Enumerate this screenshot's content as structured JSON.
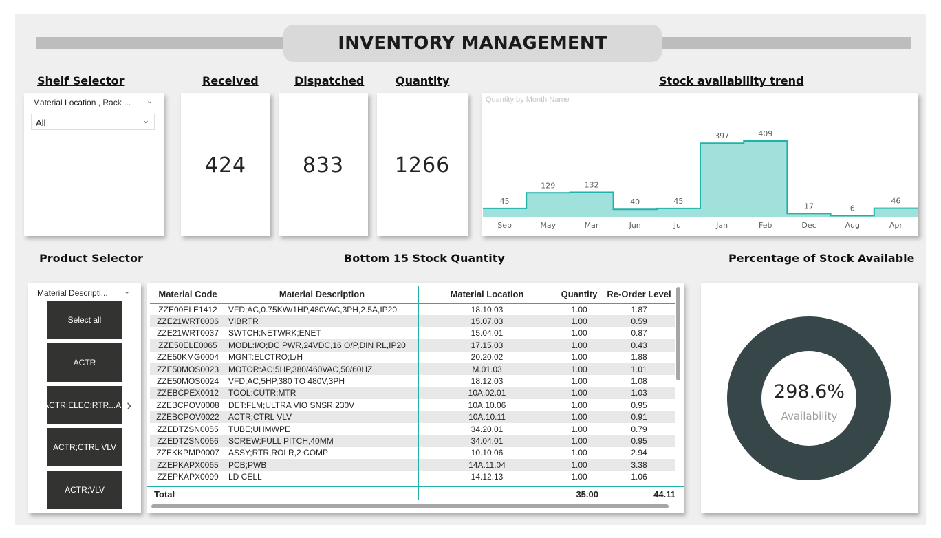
{
  "dashboard": {
    "title": "INVENTORY MANAGEMENT"
  },
  "sections": {
    "shelf_selector": "Shelf Selector",
    "received": "Received",
    "dispatched": "Dispatched",
    "quantity": "Quantity",
    "trend": "Stock availability trend",
    "product_selector": "Product Selector",
    "bottom15": "Bottom 15 Stock Quantity",
    "percentage": "Percentage of Stock Available"
  },
  "kpis": {
    "received": "424",
    "dispatched": "833",
    "quantity": "1266"
  },
  "shelf_slicer": {
    "header": "Material Location , Rack ...",
    "selected": "All"
  },
  "product_slicer": {
    "header": "Material Descripti...",
    "tiles": [
      "Select all",
      "ACTR",
      "ACTR:ELEC;RTR...AL",
      "ACTR;CTRL VLV",
      "ACTR;VLV"
    ]
  },
  "chart_data": {
    "type": "area",
    "subtitle": "Quantity by Month Name",
    "categories": [
      "Sep",
      "May",
      "Mar",
      "Jun",
      "Jul",
      "Jan",
      "Feb",
      "Dec",
      "Aug",
      "Apr"
    ],
    "values": [
      45,
      129,
      132,
      40,
      45,
      397,
      409,
      17,
      6,
      46
    ],
    "ylim": [
      0,
      409
    ],
    "color": "#20b2aa",
    "fill": "#a0e1dc"
  },
  "table": {
    "columns": [
      "Material Code",
      "Material Description",
      "Material Location",
      "Quantity",
      "Re-Order Level"
    ],
    "rows": [
      [
        "ZZE00ELE1412",
        "VFD;AC,0.75KW/1HP,480VAC,3PH,2.5A,IP20",
        "18.10.03",
        "1.00",
        "1.87"
      ],
      [
        "ZZE21WRT0006",
        "VIBRTR",
        "15.07.03",
        "1.00",
        "0.59"
      ],
      [
        "ZZE21WRT0037",
        "SWTCH:NETWRK;ENET",
        "15.04.01",
        "1.00",
        "0.87"
      ],
      [
        "ZZE50ELE0065",
        "MODL:I/O;DC PWR,24VDC,16 O/P,DIN RL,IP20",
        "17.15.03",
        "1.00",
        "0.43"
      ],
      [
        "ZZE50KMG0004",
        "MGNT:ELCTRO;L/H",
        "20.20.02",
        "1.00",
        "1.88"
      ],
      [
        "ZZE50MOS0023",
        "MOTOR:AC;5HP,380/460VAC,50/60HZ",
        "M.01.03",
        "1.00",
        "1.01"
      ],
      [
        "ZZE50MOS0024",
        "VFD;AC,5HP,380 TO 480V,3PH",
        "18.12.03",
        "1.00",
        "1.08"
      ],
      [
        "ZZEBCPEX0012",
        "TOOL:CUTR;MTR",
        "10A.02.01",
        "1.00",
        "1.03"
      ],
      [
        "ZZEBCPOV0008",
        "DET:FLM;ULTRA VIO SNSR,230V",
        "10A.10.06",
        "1.00",
        "0.95"
      ],
      [
        "ZZEBCPOV0022",
        "ACTR;CTRL VLV",
        "10A.10.11",
        "1.00",
        "0.91"
      ],
      [
        "ZZEDTZSN0055",
        "TUBE;UHMWPE",
        "34.20.01",
        "1.00",
        "0.79"
      ],
      [
        "ZZEDTZSN0066",
        "SCREW;FULL PITCH,40MM",
        "34.04.01",
        "1.00",
        "0.95"
      ],
      [
        "ZZEKKPMP0007",
        "ASSY;RTR,ROLR,2 COMP",
        "10.10.06",
        "1.00",
        "2.94"
      ],
      [
        "ZZEPKAPX0065",
        "PCB;PWB",
        "14A.11.04",
        "1.00",
        "3.38"
      ],
      [
        "ZZEPKAPX0099",
        "LD CELL",
        "14.12.13",
        "1.00",
        "1.06"
      ]
    ],
    "total_label": "Total",
    "total_quantity": "35.00",
    "total_reorder": "44.11"
  },
  "donut": {
    "value": "298.6%",
    "label": "Availability",
    "percent": 100,
    "color": "#374649"
  }
}
